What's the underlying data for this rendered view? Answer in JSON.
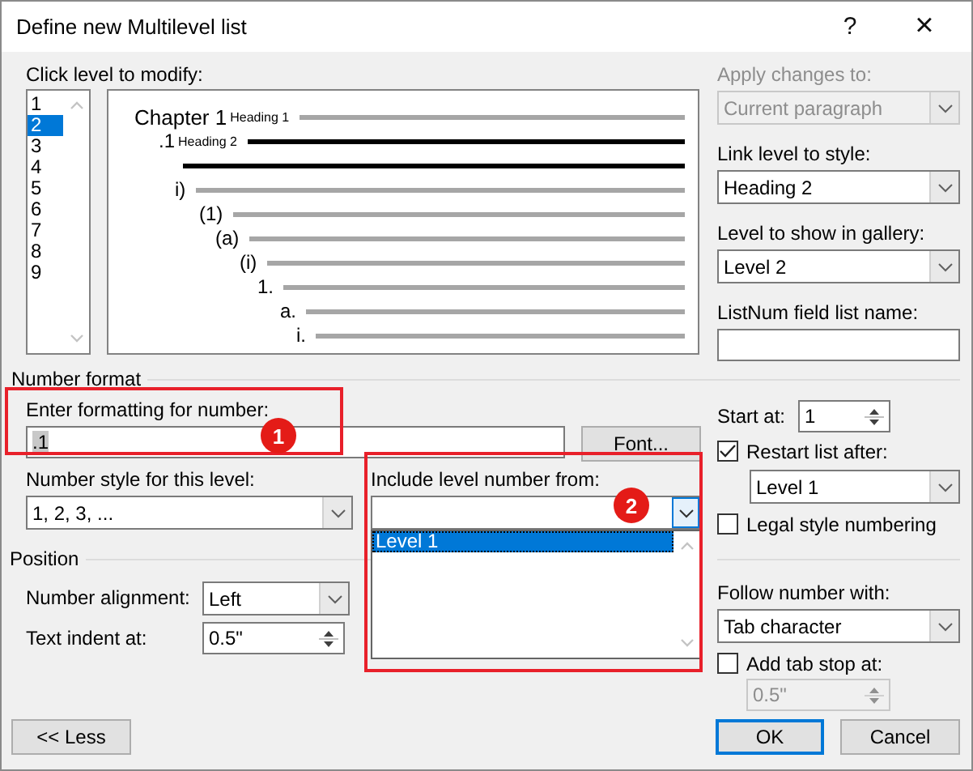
{
  "window": {
    "title": "Define new Multilevel list",
    "help": "?",
    "close": "×"
  },
  "level_picker": {
    "label": "Click level to modify:",
    "levels": [
      {
        "label": "1",
        "selected": false
      },
      {
        "label": "2",
        "selected": true
      },
      {
        "label": "3",
        "selected": false
      },
      {
        "label": "4",
        "selected": false
      },
      {
        "label": "5",
        "selected": false
      },
      {
        "label": "6",
        "selected": false
      },
      {
        "label": "7",
        "selected": false
      },
      {
        "label": "8",
        "selected": false
      },
      {
        "label": "9",
        "selected": false
      }
    ]
  },
  "preview": {
    "rows": [
      {
        "number": "Chapter 1",
        "style": "Heading 1",
        "selected": false
      },
      {
        "number": ".1",
        "style": "Heading 2",
        "selected": true
      },
      {
        "number": "i)",
        "selected": false
      },
      {
        "number": "(1)",
        "selected": false
      },
      {
        "number": "(a)",
        "selected": false
      },
      {
        "number": "(i)",
        "selected": false
      },
      {
        "number": "1.",
        "selected": false
      },
      {
        "number": "a.",
        "selected": false
      },
      {
        "number": "i.",
        "selected": false
      }
    ]
  },
  "apply_changes": {
    "label": "Apply changes to:",
    "value": "Current paragraph",
    "disabled": true
  },
  "link_level": {
    "label": "Link level to style:",
    "value": "Heading 2"
  },
  "gallery_level": {
    "label": "Level to show in gallery:",
    "value": "Level 2"
  },
  "listnum": {
    "label": "ListNum field list name:"
  },
  "number_format": {
    "heading": "Number format",
    "format_label": "Enter formatting for number:",
    "format_value": ".1",
    "font_button": "Font...",
    "style_label": "Number style for this level:",
    "style_value": "1, 2, 3, ...",
    "include_label": "Include level number from:",
    "include_options": [
      {
        "label": "Level 1",
        "selected": true
      }
    ]
  },
  "position": {
    "heading": "Position",
    "alignment_label": "Number alignment:",
    "alignment_value": "Left",
    "indent_label": "Text indent at:",
    "indent_value": "0.5\""
  },
  "start_at": {
    "label": "Start at:",
    "value": "1"
  },
  "restart": {
    "label": "Restart list after:",
    "checked": true,
    "value": "Level 1"
  },
  "legal": {
    "label": "Legal style numbering",
    "checked": false
  },
  "follow": {
    "label": "Follow number with:",
    "value": "Tab character"
  },
  "tab_stop": {
    "label": "Add tab stop at:",
    "checked": false,
    "value": "0.5\""
  },
  "buttons": {
    "less": "<< Less",
    "ok": "OK",
    "cancel": "Cancel"
  },
  "annotations": [
    {
      "number": "1"
    },
    {
      "number": "2"
    }
  ]
}
